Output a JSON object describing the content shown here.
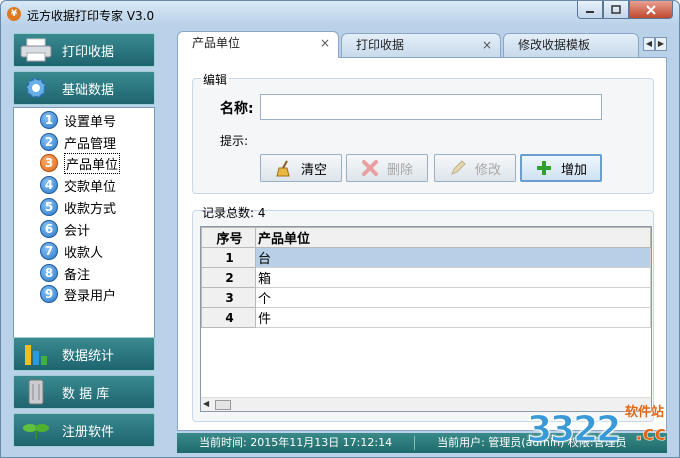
{
  "window": {
    "title": "远方收据打印专家 V3.0",
    "app_icon": "¥"
  },
  "leftnav": {
    "top_buttons": [
      {
        "label": "打印收据",
        "icon": "printer-icon"
      },
      {
        "label": "基础数据",
        "icon": "gear-icon"
      }
    ],
    "items": [
      {
        "num": "1",
        "label": "设置单号"
      },
      {
        "num": "2",
        "label": "产品管理"
      },
      {
        "num": "3",
        "label": "产品单位",
        "active": true
      },
      {
        "num": "4",
        "label": "交款单位"
      },
      {
        "num": "5",
        "label": "收款方式"
      },
      {
        "num": "6",
        "label": "会计"
      },
      {
        "num": "7",
        "label": "收款人"
      },
      {
        "num": "8",
        "label": "备注"
      },
      {
        "num": "9",
        "label": "登录用户"
      }
    ],
    "bottom_buttons": [
      {
        "label": "数据统计",
        "icon": "bar-chart-icon"
      },
      {
        "label": "数 据 库",
        "icon": "database-icon"
      },
      {
        "label": "注册软件",
        "icon": "leaf-icon"
      }
    ]
  },
  "tabs": [
    {
      "label": "产品单位",
      "active": true,
      "close": "×"
    },
    {
      "label": "打印收据",
      "close": "×"
    },
    {
      "label": "修改收据模板"
    }
  ],
  "edit": {
    "legend": "编辑",
    "name_label": "名称:",
    "name_value": "",
    "hint_label": "提示:",
    "buttons": [
      {
        "label": "清空",
        "icon": "broom-icon",
        "enabled": true
      },
      {
        "label": "删除",
        "icon": "delete-x-icon",
        "enabled": false
      },
      {
        "label": "修改",
        "icon": "pencil-icon",
        "enabled": false
      },
      {
        "label": "增加",
        "icon": "plus-icon",
        "enabled": true
      }
    ]
  },
  "records": {
    "count_label": "记录总数: 4",
    "columns": [
      "序号",
      "产品单位"
    ],
    "rows": [
      {
        "seq": "1",
        "unit": "台",
        "selected": true
      },
      {
        "seq": "2",
        "unit": "箱"
      },
      {
        "seq": "3",
        "unit": "个"
      },
      {
        "seq": "4",
        "unit": "件"
      }
    ]
  },
  "status": {
    "time": "当前时间: 2015年11月13日 17:12:14",
    "user": "当前用户: 管理员(admin)  权限:管理员"
  },
  "watermark": {
    "num": "3322",
    "cc": ".cc",
    "site": "软件站"
  },
  "colors": {
    "nav_bg": "#1e6470",
    "status_bg": "#1e6a6a",
    "selected_row": "#b8cfe8"
  }
}
